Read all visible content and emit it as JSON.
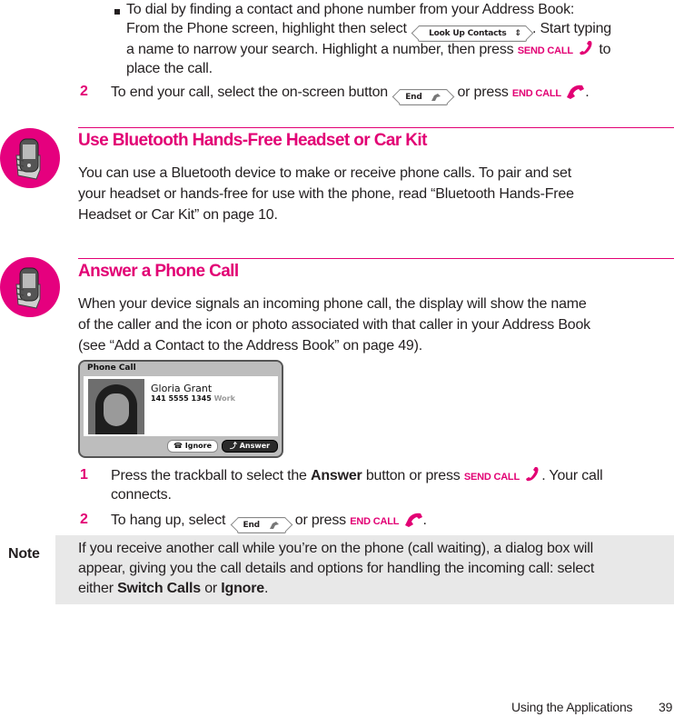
{
  "top_list": {
    "bullet_text": [
      "To dial by finding a contact and phone number from your Address Book:",
      "From the Phone screen, highlight then select",
      ". Start typing",
      "a name to narrow your search. Highlight a number, then press",
      "to",
      "place the call."
    ],
    "look_up_button": "Look Up Contacts",
    "step2_number": "2",
    "step2_text_a": "To end your call, select the on-screen button",
    "step2_text_b": "or press",
    "end_button": "End",
    "send_call_key": "SEND CALL",
    "end_call_key": "END CALL"
  },
  "bluetooth_section": {
    "heading": "Use Bluetooth Hands-Free Headset or Car Kit",
    "body": [
      "You can use a Bluetooth device to make or receive phone calls. To pair and set",
      "your headset or hands-free for use with the phone, read “Bluetooth Hands-Free",
      "Headset or Car Kit” on page 10."
    ]
  },
  "answer_section": {
    "heading": "Answer a Phone Call",
    "body": [
      "When your device signals an incoming phone call, the display will show the name",
      "of the caller and the icon or photo associated with that caller in your Address Book",
      "(see “Add a Contact to the Address Book” on page 49)."
    ],
    "screen": {
      "title": "Phone Call",
      "caller_name": "Gloria Grant",
      "caller_number": "141 5555 1345",
      "caller_label": "Work",
      "ignore_button": "Ignore",
      "answer_button": "Answer"
    },
    "steps": [
      {
        "number": "1",
        "text_a": "Press the trackball to select the",
        "bold": "Answer",
        "text_b": "button or press",
        "key": "SEND CALL",
        "text_c": ". Your call",
        "text_d": "connects."
      },
      {
        "number": "2",
        "text_a": "To hang up, select",
        "button": "End",
        "text_b": "or press",
        "key": "END CALL",
        "text_c": "."
      }
    ]
  },
  "note": {
    "label": "Note",
    "line1": "If you receive another call while you’re on the phone (call waiting), a dialog box will",
    "line2": "appear, giving you the call details and options for handling the incoming call: select",
    "line3_a": "either",
    "line3_bold1": "Switch Calls",
    "line3_b": "or",
    "line3_bold2": "Ignore",
    "line3_c": "."
  },
  "footer": {
    "section": "Using the Applications",
    "page": "39"
  },
  "colors": {
    "accent": "#e20074",
    "note_bg": "#e8e8e8",
    "text": "#231f20"
  }
}
